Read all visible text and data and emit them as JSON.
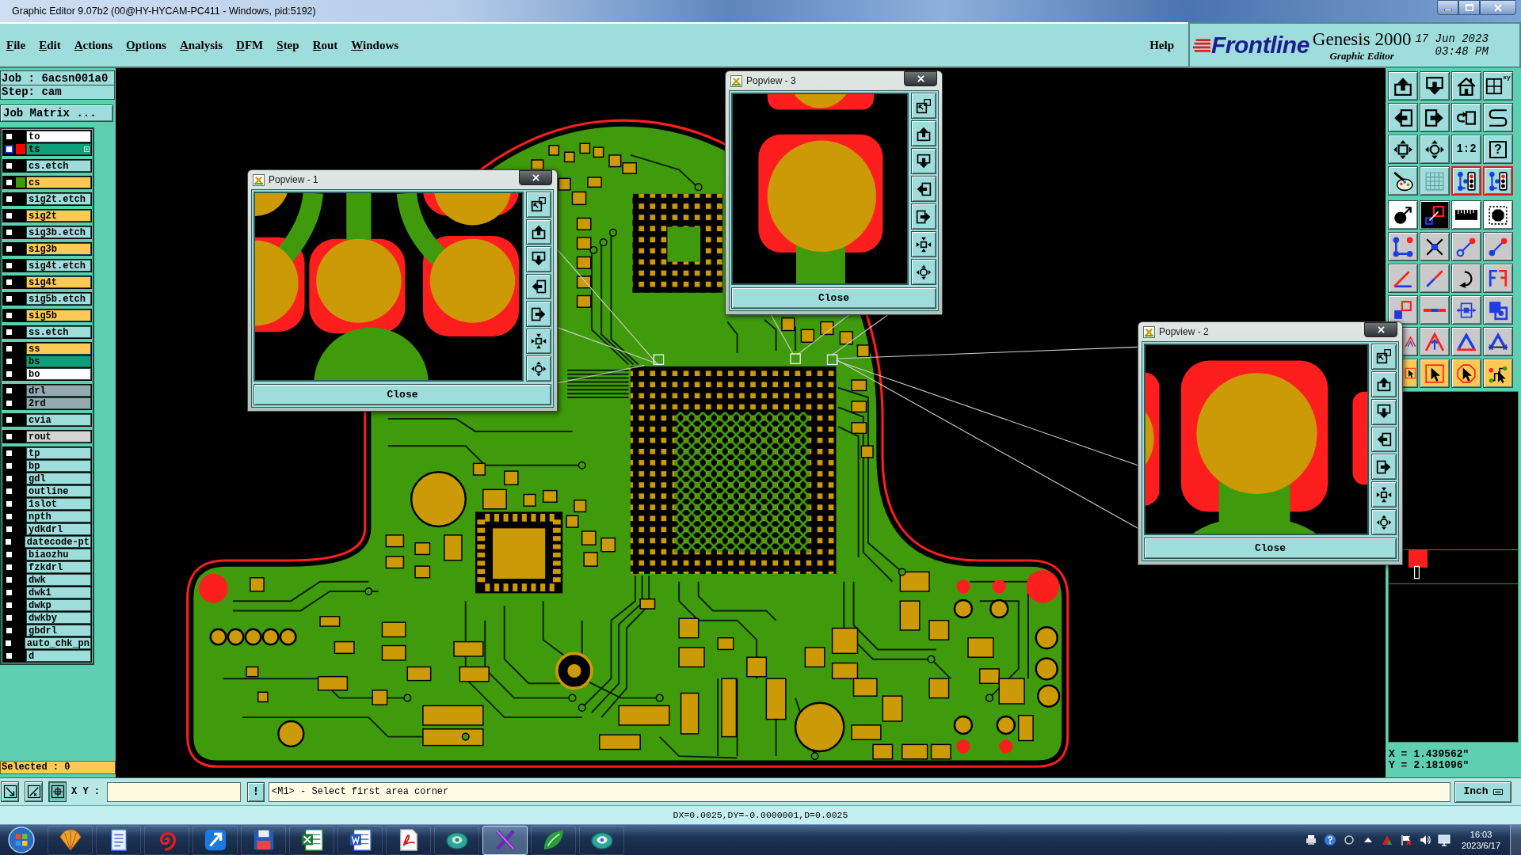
{
  "window": {
    "title": "Graphic Editor 9.07b2 (00@HY-HYCAM-PC411 - Windows, pid:5192)"
  },
  "menu": {
    "items": [
      "File",
      "Edit",
      "Actions",
      "Options",
      "Analysis",
      "DFM",
      "Step",
      "Rout",
      "Windows"
    ],
    "help": "Help"
  },
  "brand": {
    "logo": "Frontline",
    "product": "Genesis 2000",
    "subtitle": "Graphic Editor",
    "date": "17 Jun 2023",
    "time": "03:48 PM"
  },
  "layer_panel": {
    "job": "Job : 6acsn001a0",
    "step": "Step: cam",
    "matrix_button": "Job Matrix ...",
    "layer_groups": [
      {
        "layers": [
          {
            "name": "to",
            "color": "#ffffff",
            "checked": false,
            "selected": false
          },
          {
            "name": "ts",
            "color": "#0fa07a",
            "swatch": {
              "color": "#ff0000"
            },
            "checked": false,
            "selected": true
          }
        ]
      },
      {
        "layers": [
          {
            "name": "cs.etch",
            "color": "#9fdddc",
            "checked": false,
            "selected": false
          }
        ]
      },
      {
        "layers": [
          {
            "name": "cs",
            "color": "#fdc955",
            "swatch": {
              "color": "#3f9b0b"
            },
            "checked": false,
            "selected": false
          }
        ]
      },
      {
        "layers": [
          {
            "name": "sig2t.etch",
            "color": "#9fdddc",
            "checked": false,
            "selected": false
          }
        ]
      },
      {
        "layers": [
          {
            "name": "sig2t",
            "color": "#fdc955",
            "checked": false,
            "selected": false
          }
        ]
      },
      {
        "layers": [
          {
            "name": "sig3b.etch",
            "color": "#9fdddc",
            "checked": false,
            "selected": false
          }
        ]
      },
      {
        "layers": [
          {
            "name": "sig3b",
            "color": "#fdc955",
            "checked": false,
            "selected": false
          }
        ]
      },
      {
        "layers": [
          {
            "name": "sig4t.etch",
            "color": "#9fdddc",
            "checked": false,
            "selected": false
          }
        ]
      },
      {
        "layers": [
          {
            "name": "sig4t",
            "color": "#fdc955",
            "checked": false,
            "selected": false
          }
        ]
      },
      {
        "layers": [
          {
            "name": "sig5b.etch",
            "color": "#9fdddc",
            "checked": false,
            "selected": false
          }
        ]
      },
      {
        "layers": [
          {
            "name": "sig5b",
            "color": "#fdc955",
            "checked": false,
            "selected": false
          }
        ]
      },
      {
        "layers": [
          {
            "name": "ss.etch",
            "color": "#9fdddc",
            "checked": false,
            "selected": false
          }
        ]
      },
      {
        "layers": [
          {
            "name": "ss",
            "color": "#fdc955",
            "checked": false,
            "selected": false
          },
          {
            "name": "bs",
            "color": "#0fa07a",
            "checked": false,
            "selected": false
          },
          {
            "name": "bo",
            "color": "#ffffff",
            "checked": false,
            "selected": false
          }
        ]
      },
      {
        "layers": [
          {
            "name": "drl",
            "color": "#93aab0",
            "checked": false,
            "selected": false
          },
          {
            "name": "2rd",
            "color": "#93aab0",
            "checked": false,
            "selected": false
          }
        ]
      },
      {
        "layers": [
          {
            "name": "cvia",
            "color": "#9fdddc",
            "checked": false,
            "selected": false
          }
        ]
      },
      {
        "layers": [
          {
            "name": "rout",
            "color": "#d4d4d4",
            "checked": false,
            "selected": false
          }
        ]
      },
      {
        "layers": [
          {
            "name": "tp",
            "color": "#9fdddc",
            "checked": false,
            "selected": false
          },
          {
            "name": "bp",
            "color": "#9fdddc",
            "checked": false,
            "selected": false
          },
          {
            "name": "gdl",
            "color": "#9fdddc",
            "checked": false,
            "selected": false
          },
          {
            "name": "outline",
            "color": "#9fdddc",
            "checked": false,
            "selected": false
          },
          {
            "name": "1slot",
            "color": "#9fdddc",
            "checked": false,
            "selected": false
          },
          {
            "name": "npth",
            "color": "#9fdddc",
            "checked": false,
            "selected": false
          },
          {
            "name": "ydkdrl",
            "color": "#9fdddc",
            "checked": false,
            "selected": false
          },
          {
            "name": "datecode-pt",
            "color": "#9fdddc",
            "checked": false,
            "selected": false
          },
          {
            "name": "biaozhu",
            "color": "#9fdddc",
            "checked": false,
            "selected": false
          },
          {
            "name": "fzkdrl",
            "color": "#9fdddc",
            "checked": false,
            "selected": false
          },
          {
            "name": "dwk",
            "color": "#9fdddc",
            "checked": false,
            "selected": false
          },
          {
            "name": "dwk1",
            "color": "#9fdddc",
            "checked": false,
            "selected": false
          },
          {
            "name": "dwkp",
            "color": "#9fdddc",
            "checked": false,
            "selected": false
          },
          {
            "name": "dwkby",
            "color": "#9fdddc",
            "checked": false,
            "selected": false
          },
          {
            "name": "gbdrl",
            "color": "#9fdddc",
            "checked": false,
            "selected": false
          },
          {
            "name": "auto_chk_pn",
            "color": "#9fdddc",
            "checked": false,
            "selected": false
          },
          {
            "name": "d",
            "color": "#9fdddc",
            "checked": false,
            "selected": false
          }
        ]
      }
    ],
    "selected_count": "Selected : 0"
  },
  "popviews": [
    {
      "title": "Popview - 1",
      "close_button": "Close"
    },
    {
      "title": "Popview - 3",
      "close_button": "Close"
    },
    {
      "title": "Popview - 2",
      "close_button": "Close"
    }
  ],
  "toolbar": {
    "grid_label": "xy",
    "scale_label": "1:2",
    "question_label": "?",
    "toggles": [
      {
        "on": true
      },
      {
        "on": true
      }
    ]
  },
  "coordinates": {
    "x": "X = 1.439562\"",
    "y": "Y = 2.181096\""
  },
  "command_bar": {
    "xy_label": "X Y :",
    "alert_button": "!",
    "message": "<M1> - Select first area corner",
    "units": "Inch"
  },
  "status_bar": {
    "text": "DX=0.0025,DY=-0.0000001,D=0.0025"
  },
  "taskbar": {
    "apps": [
      {
        "selected": false
      },
      {
        "selected": false
      },
      {
        "selected": false
      },
      {
        "selected": false
      },
      {
        "selected": false
      },
      {
        "selected": false
      },
      {
        "selected": false
      },
      {
        "selected": false
      },
      {
        "selected": false
      },
      {
        "selected": true
      },
      {
        "selected": false
      },
      {
        "selected": false
      }
    ],
    "time": "16:03",
    "date": "2023/6/17"
  }
}
